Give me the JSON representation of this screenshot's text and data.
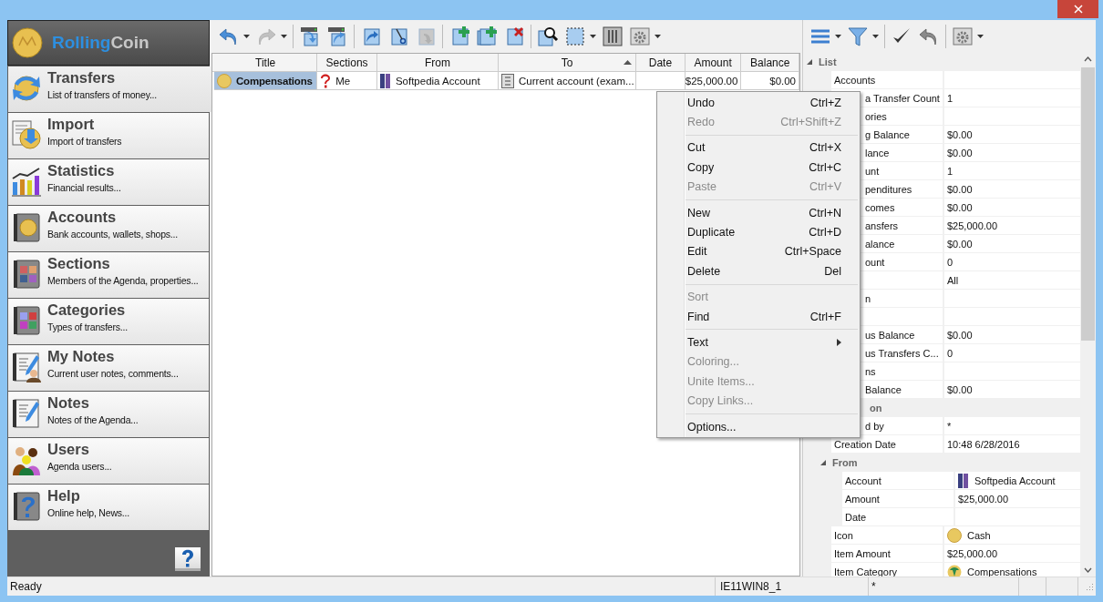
{
  "brand": {
    "name_parts": [
      "Rolling",
      "Coin"
    ]
  },
  "sidebar": {
    "items": [
      {
        "kind": "transfers",
        "title": "Transfers",
        "subtitle": "List of transfers of money...",
        "selected": true
      },
      {
        "kind": "import",
        "title": "Import",
        "subtitle": "Import of transfers",
        "selected": false
      },
      {
        "kind": "statistics",
        "title": "Statistics",
        "subtitle": "Financial results...",
        "selected": false
      },
      {
        "kind": "accounts",
        "title": "Accounts",
        "subtitle": "Bank accounts, wallets, shops...",
        "selected": false
      },
      {
        "kind": "sections",
        "title": "Sections",
        "subtitle": "Members of the Agenda, properties...",
        "selected": false
      },
      {
        "kind": "categories",
        "title": "Categories",
        "subtitle": "Types of transfers...",
        "selected": false
      },
      {
        "kind": "user-notes",
        "title": "My Notes",
        "subtitle": "Current user notes, comments...",
        "selected": false
      },
      {
        "kind": "notes",
        "title": "Notes",
        "subtitle": "Notes of the Agenda...",
        "selected": false
      },
      {
        "kind": "users",
        "title": "Users",
        "subtitle": "Agenda users...",
        "selected": false
      },
      {
        "kind": "help",
        "title": "Help",
        "subtitle": "Online help, News...",
        "selected": false
      }
    ]
  },
  "toolbar": [
    {
      "kind": "undo",
      "disabled": false,
      "dropdown": true
    },
    {
      "kind": "redo",
      "disabled": true,
      "dropdown": true
    },
    {
      "kind": "separator"
    },
    {
      "kind": "drive-in",
      "disabled": false,
      "dropdown": false
    },
    {
      "kind": "drive-out",
      "disabled": false,
      "dropdown": false
    },
    {
      "kind": "separator"
    },
    {
      "kind": "doc-arrow",
      "disabled": false,
      "dropdown": false
    },
    {
      "kind": "doc-scissors",
      "disabled": false,
      "dropdown": false
    },
    {
      "kind": "doc-paste",
      "disabled": true,
      "dropdown": false
    },
    {
      "kind": "separator"
    },
    {
      "kind": "doc-plus",
      "disabled": false,
      "dropdown": false
    },
    {
      "kind": "docs-plus",
      "disabled": false,
      "dropdown": false
    },
    {
      "kind": "doc-delete",
      "disabled": false,
      "dropdown": false
    },
    {
      "kind": "separator"
    },
    {
      "kind": "find",
      "disabled": false,
      "dropdown": false
    },
    {
      "kind": "select",
      "disabled": false,
      "dropdown": true
    },
    {
      "kind": "columns",
      "disabled": false,
      "dropdown": false
    },
    {
      "kind": "settings",
      "disabled": false,
      "dropdown": true
    }
  ],
  "table": {
    "columns": [
      {
        "label": "Title",
        "sorted": false
      },
      {
        "label": "Sections",
        "sorted": false
      },
      {
        "label": "From",
        "sorted": false
      },
      {
        "label": "To",
        "sorted": true
      },
      {
        "label": "Date",
        "sorted": false
      },
      {
        "label": "Amount",
        "sorted": false
      },
      {
        "label": "Balance",
        "sorted": false
      }
    ],
    "rows": [
      {
        "selected": true,
        "title": "Compensations",
        "sections": "Me",
        "from": "Softpedia Account",
        "to": "Current account (exam...",
        "amount": "$25,000.00",
        "balance": "$0.00"
      }
    ]
  },
  "context_menu": {
    "items": [
      {
        "kind": "item",
        "label": "Undo",
        "shortcut": "Ctrl+Z",
        "disabled": false
      },
      {
        "kind": "item",
        "label": "Redo",
        "shortcut": "Ctrl+Shift+Z",
        "disabled": true
      },
      {
        "kind": "separator"
      },
      {
        "kind": "item",
        "label": "Cut",
        "shortcut": "Ctrl+X",
        "disabled": false
      },
      {
        "kind": "item",
        "label": "Copy",
        "shortcut": "Ctrl+C",
        "disabled": false
      },
      {
        "kind": "item",
        "label": "Paste",
        "shortcut": "Ctrl+V",
        "disabled": true
      },
      {
        "kind": "separator"
      },
      {
        "kind": "item",
        "label": "New",
        "shortcut": "Ctrl+N",
        "disabled": false
      },
      {
        "kind": "item",
        "label": "Duplicate",
        "shortcut": "Ctrl+D",
        "disabled": false
      },
      {
        "kind": "item",
        "label": "Edit",
        "shortcut": "Ctrl+Space",
        "disabled": false
      },
      {
        "kind": "item",
        "label": "Delete",
        "shortcut": "Del",
        "disabled": false
      },
      {
        "kind": "separator"
      },
      {
        "kind": "item",
        "label": "Sort",
        "disabled": true
      },
      {
        "kind": "item",
        "label": "Find",
        "shortcut": "Ctrl+F",
        "disabled": false
      },
      {
        "kind": "separator"
      },
      {
        "kind": "submenu",
        "label": "Text",
        "disabled": false
      },
      {
        "kind": "item",
        "label": "Coloring...",
        "disabled": true
      },
      {
        "kind": "item",
        "label": "Unite Items...",
        "disabled": true
      },
      {
        "kind": "item",
        "label": "Copy Links...",
        "disabled": true
      },
      {
        "kind": "separator"
      },
      {
        "kind": "item",
        "label": "Options...",
        "disabled": false
      }
    ]
  },
  "properties_toolbar": [
    {
      "kind": "lines",
      "disabled": false,
      "dropdown": true
    },
    {
      "kind": "filter",
      "disabled": false,
      "dropdown": true
    },
    {
      "kind": "separator"
    },
    {
      "kind": "check",
      "disabled": false,
      "dropdown": false
    },
    {
      "kind": "undo-gray",
      "disabled": false,
      "dropdown": false
    },
    {
      "kind": "separator"
    },
    {
      "kind": "settings",
      "disabled": false,
      "dropdown": true
    }
  ],
  "properties": [
    {
      "kind": "group",
      "label": "List",
      "expanded": true,
      "children": [
        {
          "kind": "property",
          "name": "Accounts",
          "covered": false
        },
        {
          "kind": "property",
          "name": "a Transfer Count",
          "value": "1",
          "covered": true
        },
        {
          "kind": "property",
          "name": "ories",
          "covered": true
        },
        {
          "kind": "property",
          "name": "g Balance",
          "value": "$0.00",
          "covered": true
        },
        {
          "kind": "property",
          "name": "lance",
          "value": "$0.00",
          "covered": true
        },
        {
          "kind": "property",
          "name": "unt",
          "value": "1",
          "covered": true
        },
        {
          "kind": "property",
          "name": "penditures",
          "value": "$0.00",
          "covered": true
        },
        {
          "kind": "property",
          "name": "comes",
          "value": "$0.00",
          "covered": true
        },
        {
          "kind": "property",
          "name": "ansfers",
          "value": "$25,000.00",
          "covered": true
        },
        {
          "kind": "property",
          "name": "alance",
          "value": "$0.00",
          "covered": true
        },
        {
          "kind": "property",
          "name": "ount",
          "value": "0",
          "covered": true
        },
        {
          "kind": "property",
          "value": "All"
        },
        {
          "kind": "property",
          "name": "n",
          "covered": true
        },
        {
          "kind": "property"
        },
        {
          "kind": "property",
          "name": "us Balance",
          "value": "$0.00",
          "covered": true
        },
        {
          "kind": "property",
          "name": "us Transfers C...",
          "value": "0",
          "covered": true
        },
        {
          "kind": "property",
          "name": "ns",
          "covered": true
        },
        {
          "kind": "property",
          "name": "Balance",
          "value": "$0.00",
          "covered": true
        }
      ]
    },
    {
      "kind": "group",
      "label": "on",
      "covered": true,
      "children": [
        {
          "kind": "property",
          "name": "d by",
          "value": "*",
          "covered": true
        },
        {
          "kind": "property",
          "name": "Creation Date",
          "value": "10:48 6/28/2016",
          "covered": false
        },
        {
          "kind": "group",
          "label": "From",
          "expanded": true,
          "children": [
            {
              "kind": "binder",
              "name": "Account",
              "value": "Softpedia Account",
              "covered": false
            },
            {
              "kind": "property",
              "name": "Amount",
              "value": "$25,000.00",
              "covered": false
            },
            {
              "kind": "property",
              "name": "Date",
              "covered": false
            }
          ]
        },
        {
          "kind": "coin",
          "name": "Icon",
          "value": "Cash",
          "covered": false
        },
        {
          "kind": "property",
          "name": "Item Amount",
          "value": "$25,000.00",
          "covered": false
        },
        {
          "kind": "category",
          "name": "Item Category",
          "value": "Compensations",
          "covered": false
        }
      ]
    }
  ],
  "status_bar": {
    "message": "Ready",
    "machine": "IE11WIN8_1",
    "flag": "*"
  }
}
